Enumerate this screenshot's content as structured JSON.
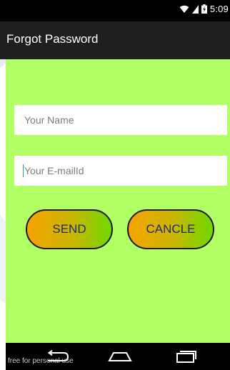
{
  "status_bar": {
    "time": "5:09",
    "icons": [
      "wifi-icon",
      "signal-icon",
      "battery-icon"
    ]
  },
  "app_bar": {
    "title": "Forgot Password"
  },
  "form": {
    "name_placeholder": "Your Name",
    "email_placeholder": "Your E-mailId",
    "send_label": "SEND",
    "cancel_label": "CANCLE"
  },
  "nav_bar": {
    "icons": [
      "back-icon",
      "home-icon",
      "recents-icon"
    ],
    "watermark_text": "free for personal use"
  },
  "colors": {
    "content_background": "#b3ff66",
    "button_gradient_start": "#f5a300",
    "button_gradient_end": "#6ed800",
    "button_text": "#1f2a6b",
    "action_bar": "#1f1f1f"
  }
}
